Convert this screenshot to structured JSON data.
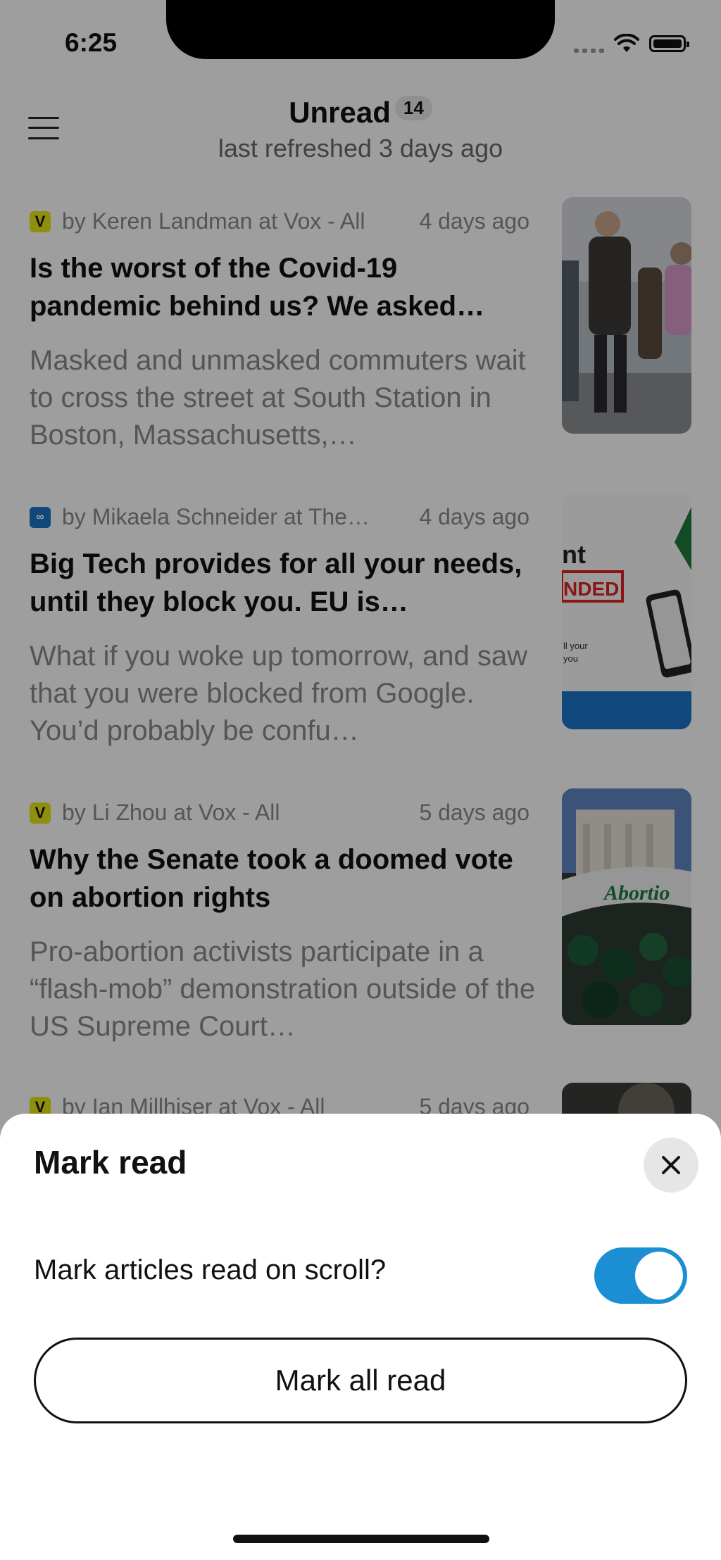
{
  "status_bar": {
    "time": "6:25",
    "icons": [
      "cellular-icon",
      "wifi-icon",
      "battery-icon"
    ]
  },
  "header": {
    "title": "Unread",
    "unread_count": "14",
    "subtitle": "last refreshed 3 days ago",
    "menu_icon": "hamburger-menu-icon"
  },
  "articles": [
    {
      "feed_icon": "V",
      "author": "by Keren Landman at Vox -  All",
      "age": "4 days ago",
      "headline": "Is the worst of the Covid-19 pandemic behind us? We asked…",
      "excerpt": "Masked and unmasked commuters wait to cross the street at South Station in Boston, Massachusetts,…"
    },
    {
      "feed_icon": "∞",
      "author": "by Mikaela Schneider at The…",
      "age": "4 days ago",
      "headline": "Big Tech provides for all your needs, until they block you. EU is…",
      "excerpt": "What if you woke up tomorrow, and saw that you were blocked from Google.   You’d probably be confu…"
    },
    {
      "feed_icon": "V",
      "author": "by Li Zhou at Vox -  All",
      "age": "5 days ago",
      "headline": "Why the Senate took a doomed vote on abortion rights",
      "excerpt": "Pro-abortion activists participate in a “flash-mob” demonstration outside of the US Supreme Court…"
    },
    {
      "feed_icon": "V",
      "author": "by Ian Millhiser at Vox -  All",
      "age": "5 days ago",
      "headline": "",
      "excerpt": ""
    }
  ],
  "thumbnail_texts": {
    "article2_line1": "nt",
    "article2_line2": "NDED",
    "article2_line3": "ll your",
    "article2_line4": "you",
    "article3_banner": "Abortio"
  },
  "sheet": {
    "title": "Mark read",
    "close_icon": "close-icon",
    "toggle_label": "Mark articles read on scroll?",
    "toggle_on": true,
    "mark_all_label": "Mark all read"
  },
  "colors": {
    "accent": "#1c8ed3",
    "vox_yellow": "#e8e515",
    "overlay": "rgba(0,0,0,0.38)"
  }
}
